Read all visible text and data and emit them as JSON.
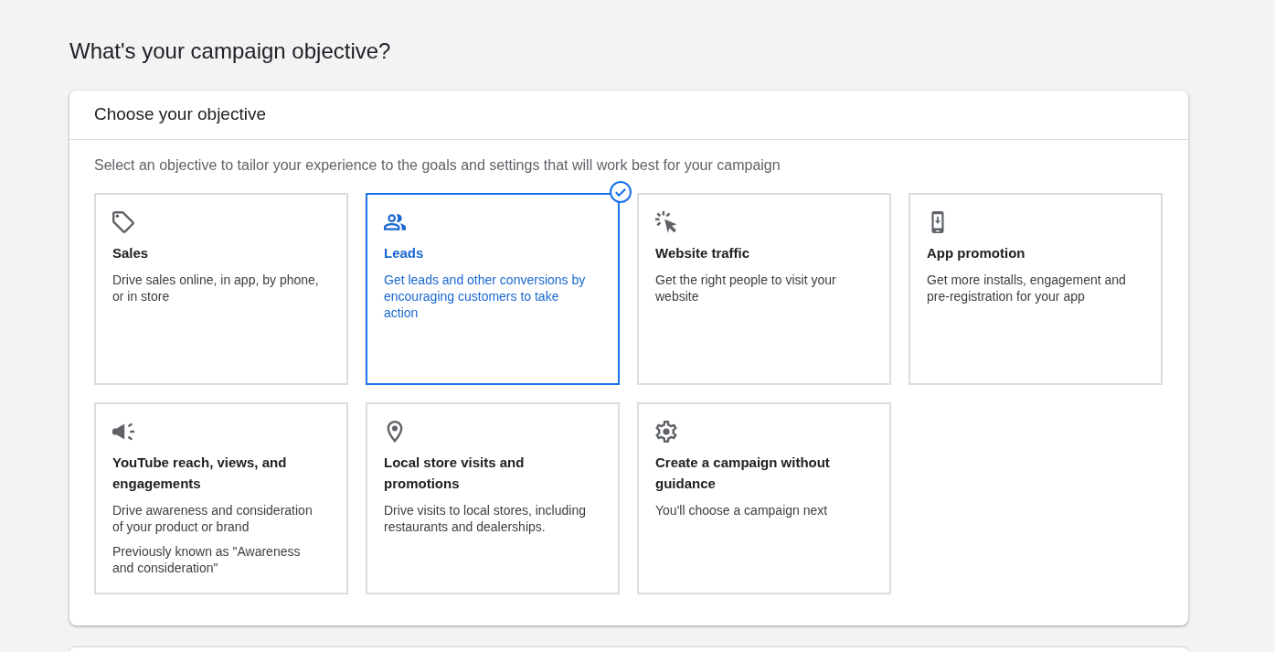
{
  "page": {
    "title": "What's your campaign objective?"
  },
  "objective_card": {
    "title": "Choose your objective",
    "instructions": "Select an objective to tailor your experience to the goals and settings that will work best for your campaign",
    "objectives": [
      {
        "title": "Sales",
        "descriptions": [
          "Drive sales online, in app, by phone, or in store"
        ],
        "selected": false
      },
      {
        "title": "Leads",
        "descriptions": [
          "Get leads and other conversions by encouraging customers to take action"
        ],
        "selected": true
      },
      {
        "title": "Website traffic",
        "descriptions": [
          "Get the right people to visit your website"
        ],
        "selected": false
      },
      {
        "title": "App promotion",
        "descriptions": [
          "Get more installs, engagement and pre-registration for your app"
        ],
        "selected": false
      },
      {
        "title": "YouTube reach, views, and engagements",
        "descriptions": [
          "Drive awareness and consideration of your product or brand",
          "Previously known as \"Awareness and consideration\""
        ],
        "selected": false
      },
      {
        "title": "Local store visits and promotions",
        "descriptions": [
          "Drive visits to local stores, including restaurants and dealerships."
        ],
        "selected": false
      },
      {
        "title": "Create a campaign without guidance",
        "descriptions": [
          "You'll choose a campaign next"
        ],
        "selected": false
      }
    ]
  }
}
